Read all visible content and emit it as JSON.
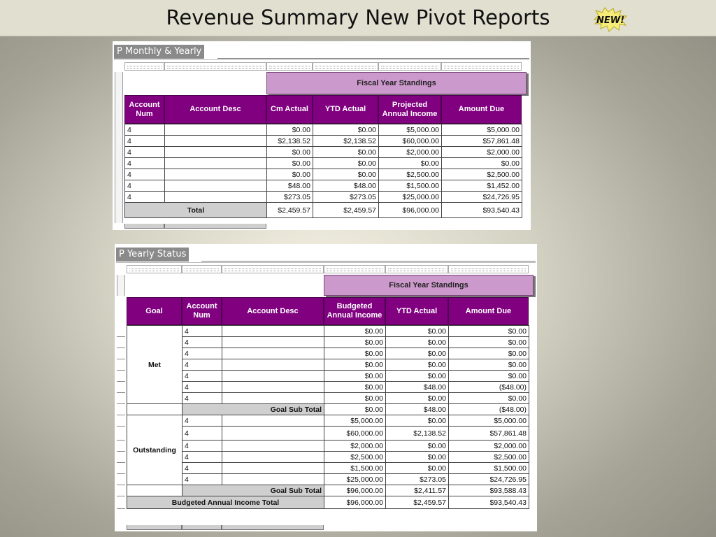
{
  "slide": {
    "title": "Revenue Summary New Pivot Reports",
    "badge": "NEW!"
  },
  "report1": {
    "tab": "P Monthly & Yearly",
    "fiscal_header": "Fiscal Year Standings",
    "columns": [
      "Account Num",
      "Account Desc",
      "Cm Actual",
      "YTD Actual",
      "Projected Annual Income",
      "Amount Due"
    ],
    "rows": [
      {
        "acct": "4",
        "desc": "",
        "cm": "$0.00",
        "ytd": "$0.00",
        "proj": "$5,000.00",
        "due": "$5,000.00"
      },
      {
        "acct": "4",
        "desc": "",
        "cm": "$2,138.52",
        "ytd": "$2,138.52",
        "proj": "$60,000.00",
        "due": "$57,861.48"
      },
      {
        "acct": "4",
        "desc": "",
        "cm": "$0.00",
        "ytd": "$0.00",
        "proj": "$2,000.00",
        "due": "$2,000.00"
      },
      {
        "acct": "4",
        "desc": "",
        "cm": "$0.00",
        "ytd": "$0.00",
        "proj": "$0.00",
        "due": "$0.00"
      },
      {
        "acct": "4",
        "desc": "",
        "cm": "$0.00",
        "ytd": "$0.00",
        "proj": "$2,500.00",
        "due": "$2,500.00"
      },
      {
        "acct": "4",
        "desc": "",
        "cm": "$48.00",
        "ytd": "$48.00",
        "proj": "$1,500.00",
        "due": "$1,452.00"
      },
      {
        "acct": "4",
        "desc": "",
        "cm": "$273.05",
        "ytd": "$273.05",
        "proj": "$25,000.00",
        "due": "$24,726.95"
      }
    ],
    "total": {
      "label": "Total",
      "cm": "$2,459.57",
      "ytd": "$2,459.57",
      "proj": "$96,000.00",
      "due": "$93,540.43"
    }
  },
  "report2": {
    "tab": "P Yearly Status",
    "fiscal_header": "Fiscal Year Standings",
    "columns": [
      "Goal",
      "Account Num",
      "Account Desc",
      "Budgeted Annual Income",
      "YTD Actual",
      "Amount Due"
    ],
    "groups": [
      {
        "goal": "Met",
        "rows": [
          {
            "acct": "4",
            "desc": "",
            "budget": "$0.00",
            "ytd": "$0.00",
            "due": "$0.00"
          },
          {
            "acct": "4",
            "desc": "",
            "budget": "$0.00",
            "ytd": "$0.00",
            "due": "$0.00"
          },
          {
            "acct": "4",
            "desc": "",
            "budget": "$0.00",
            "ytd": "$0.00",
            "due": "$0.00"
          },
          {
            "acct": "4",
            "desc": "",
            "budget": "$0.00",
            "ytd": "$0.00",
            "due": "$0.00"
          },
          {
            "acct": "4",
            "desc": "",
            "budget": "$0.00",
            "ytd": "$0.00",
            "due": "$0.00"
          },
          {
            "acct": "4",
            "desc": "",
            "budget": "$0.00",
            "ytd": "$48.00",
            "due": "($48.00)"
          },
          {
            "acct": "4",
            "desc": "",
            "budget": "$0.00",
            "ytd": "$0.00",
            "due": "$0.00"
          }
        ],
        "subtotal": {
          "label": "Goal Sub Total",
          "budget": "$0.00",
          "ytd": "$48.00",
          "due": "($48.00)"
        }
      },
      {
        "goal": "Outstanding",
        "rows": [
          {
            "acct": "4",
            "desc": "",
            "budget": "$5,000.00",
            "ytd": "$0.00",
            "due": "$5,000.00"
          },
          {
            "acct": "4",
            "desc": "",
            "budget": "$60,000.00",
            "ytd": "$2,138.52",
            "due": "$57,861.48"
          },
          {
            "acct": "4",
            "desc": "",
            "budget": "$2,000.00",
            "ytd": "$0.00",
            "due": "$2,000.00"
          },
          {
            "acct": "4",
            "desc": "",
            "budget": "$2,500.00",
            "ytd": "$0.00",
            "due": "$2,500.00"
          },
          {
            "acct": "4",
            "desc": "",
            "budget": "$1,500.00",
            "ytd": "$0.00",
            "due": "$1,500.00"
          },
          {
            "acct": "4",
            "desc": "",
            "budget": "$25,000.00",
            "ytd": "$273.05",
            "due": "$24,726.95"
          }
        ],
        "subtotal": {
          "label": "Goal Sub Total",
          "budget": "$96,000.00",
          "ytd": "$2,411.57",
          "due": "$93,588.43"
        }
      }
    ],
    "grand_total": {
      "label": "Budgeted Annual Income Total",
      "budget": "$96,000.00",
      "ytd": "$2,459.57",
      "due": "$93,540.43"
    }
  }
}
